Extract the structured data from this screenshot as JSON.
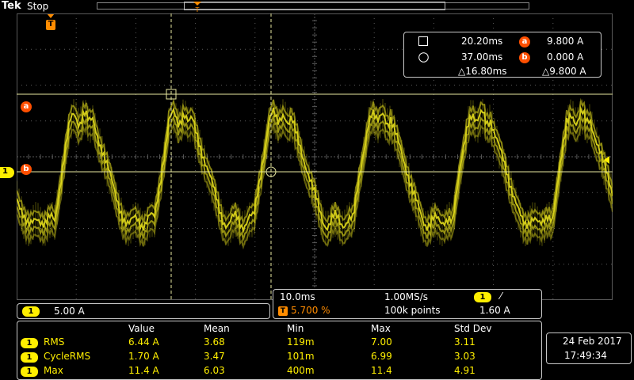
{
  "header": {
    "brand": "Tek",
    "status": "Stop"
  },
  "markers": {
    "trigger_label": "T",
    "cursor_a_label": "a",
    "cursor_b_label": "b",
    "channel_label": "1"
  },
  "cursors": {
    "a_time": "20.20ms",
    "a_value": "9.800 A",
    "b_time": "37.00ms",
    "b_value": "0.000 A",
    "delta_time": "△16.80ms",
    "delta_value": "△9.800 A"
  },
  "channel": {
    "number": "1",
    "scale": "5.00 A"
  },
  "timebase": {
    "time_div": "10.0ms",
    "sample_rate": "1.00MS/s",
    "trigger_position": "5.700 %",
    "record_length": "100k points",
    "trigger_channel": "1",
    "trigger_slope": "⁄",
    "trigger_level": "1.60 A"
  },
  "measurements": {
    "headers": [
      "Value",
      "Mean",
      "Min",
      "Max",
      "Std Dev"
    ],
    "rows": [
      {
        "ch": "1",
        "name": "RMS",
        "value": "6.44 A",
        "mean": "3.68",
        "min": "119m",
        "max": "7.00",
        "std": "3.11"
      },
      {
        "ch": "1",
        "name": "CycleRMS",
        "value": "1.70 A",
        "mean": "3.47",
        "min": "101m",
        "max": "6.99",
        "std": "3.03"
      },
      {
        "ch": "1",
        "name": "Max",
        "value": "11.4 A",
        "mean": "6.03",
        "min": "400m",
        "max": "11.4",
        "std": "4.91"
      }
    ]
  },
  "datetime": {
    "date": "24 Feb  2017",
    "time": "17:49:34"
  },
  "colors": {
    "trace": "#e6df1c",
    "cursor": "#ff4f00",
    "grid": "#5a5a5a",
    "channel_badge": "#ffef00"
  }
}
